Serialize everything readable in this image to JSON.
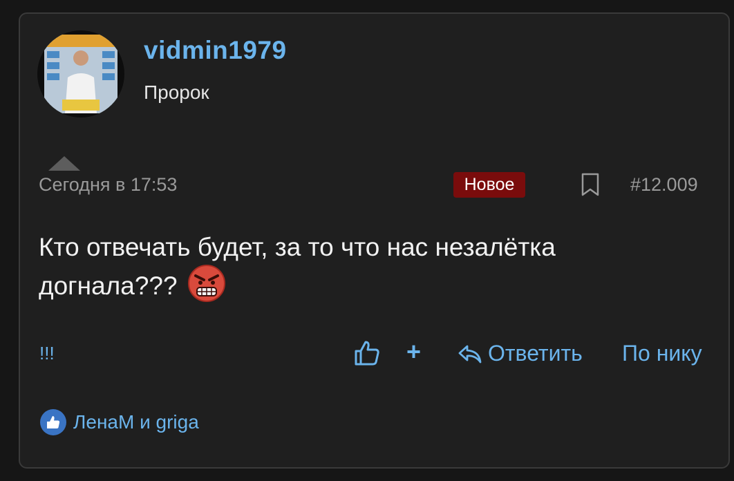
{
  "post": {
    "author": {
      "username": "vidmin1979",
      "title": "Пророк"
    },
    "date": "Сегодня в 17:53",
    "badge": "Новое",
    "number": "#12.009",
    "text": "Кто отвечать будет, за то что нас незалётка догнала???",
    "reactions_link": "!!!",
    "actions": {
      "plus": "+",
      "reply": "Ответить",
      "by_nick": "По нику"
    },
    "liked_by": "ЛенаМ и griga"
  },
  "colors": {
    "accent": "#6bb4ec",
    "badge_bg": "#7a0c0c",
    "card_bg": "#1f1f1f",
    "page_bg": "#161616"
  },
  "icons": [
    "avatar-photo",
    "caret-up-icon",
    "bookmark-icon",
    "angry-face-emoji",
    "thumbs-up-icon",
    "reply-arrow-icon",
    "like-badge-icon"
  ]
}
